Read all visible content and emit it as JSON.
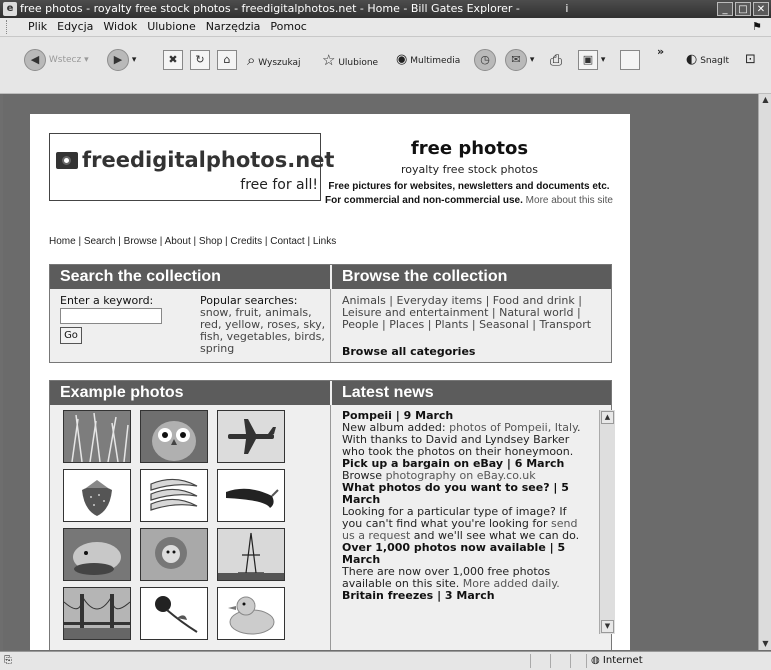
{
  "window": {
    "title": "free photos - royalty free stock photos - freedigitalphotos.net - Home - Bill Gates Explorer -",
    "title_suffix": "i"
  },
  "menu": [
    "Plik",
    "Edycja",
    "Widok",
    "Ulubione",
    "Narzędzia",
    "Pomoc"
  ],
  "toolbar": {
    "back": "Wstecz",
    "search": "Wyszukaj",
    "favorites": "Ulubione",
    "media": "Multimedia",
    "snagit": "SnagIt",
    "chevron": "»"
  },
  "status": {
    "zone": "Internet"
  },
  "site": {
    "logo_text": "freedigitalphotos.net",
    "logo_tagline": "free for all!",
    "heading": "free photos",
    "subheading": "royalty free stock photos",
    "desc_line1": "Free pictures for websites, newsletters and documents etc.",
    "desc_line2": "For commercial and non-commercial use.",
    "desc_link": "More about this site",
    "nav": "Home | Search | Browse | About | Shop | Credits | Contact | Links"
  },
  "search_box": {
    "title": "Search the collection",
    "keyword_label": "Enter a keyword:",
    "keyword_value": "",
    "go_label": "Go",
    "popular_label": "Popular searches:",
    "popular_terms": "snow, fruit, animals, red, yellow, roses, sky, fish, vegetables, birds, spring"
  },
  "browse_box": {
    "title": "Browse the collection",
    "categories": "Animals | Everyday items | Food and drink | Leisure and entertainment | Natural world | People | Places | Plants | Seasonal | Transport",
    "all_label": "Browse all categories"
  },
  "examples": {
    "title": "Example photos",
    "thumbs": [
      "grass",
      "owl",
      "airplane",
      "strawberry",
      "bananas",
      "chili pepper",
      "hamster",
      "lion",
      "eiffel tower",
      "golden gate bridge",
      "rose",
      "rubber duck"
    ]
  },
  "news": {
    "title": "Latest news",
    "items": [
      {
        "head": "Pompeii | 9 March",
        "pre": "New album added: ",
        "link": "photos of Pompeii, Italy",
        "post": ". With thanks to David and Lyndsey Barker who took the photos on their honeymoon."
      },
      {
        "head": "Pick up a bargain on eBay | 6 March",
        "pre": "Browse ",
        "link": "photography on eBay.co.uk",
        "post": ""
      },
      {
        "head": "What photos do you want to see? | 5 March",
        "pre": "Looking for a particular type of image? If you can't find what you're looking for ",
        "link": "send us a request",
        "post": " and we'll see what we can do."
      },
      {
        "head": "Over 1,000 photos now available | 5 March",
        "pre": "There are now over 1,000 free photos available on this site. ",
        "link": "More added daily.",
        "post": ""
      },
      {
        "head": "Britain freezes | 3 March",
        "pre": "",
        "link": "",
        "post": ""
      }
    ]
  }
}
